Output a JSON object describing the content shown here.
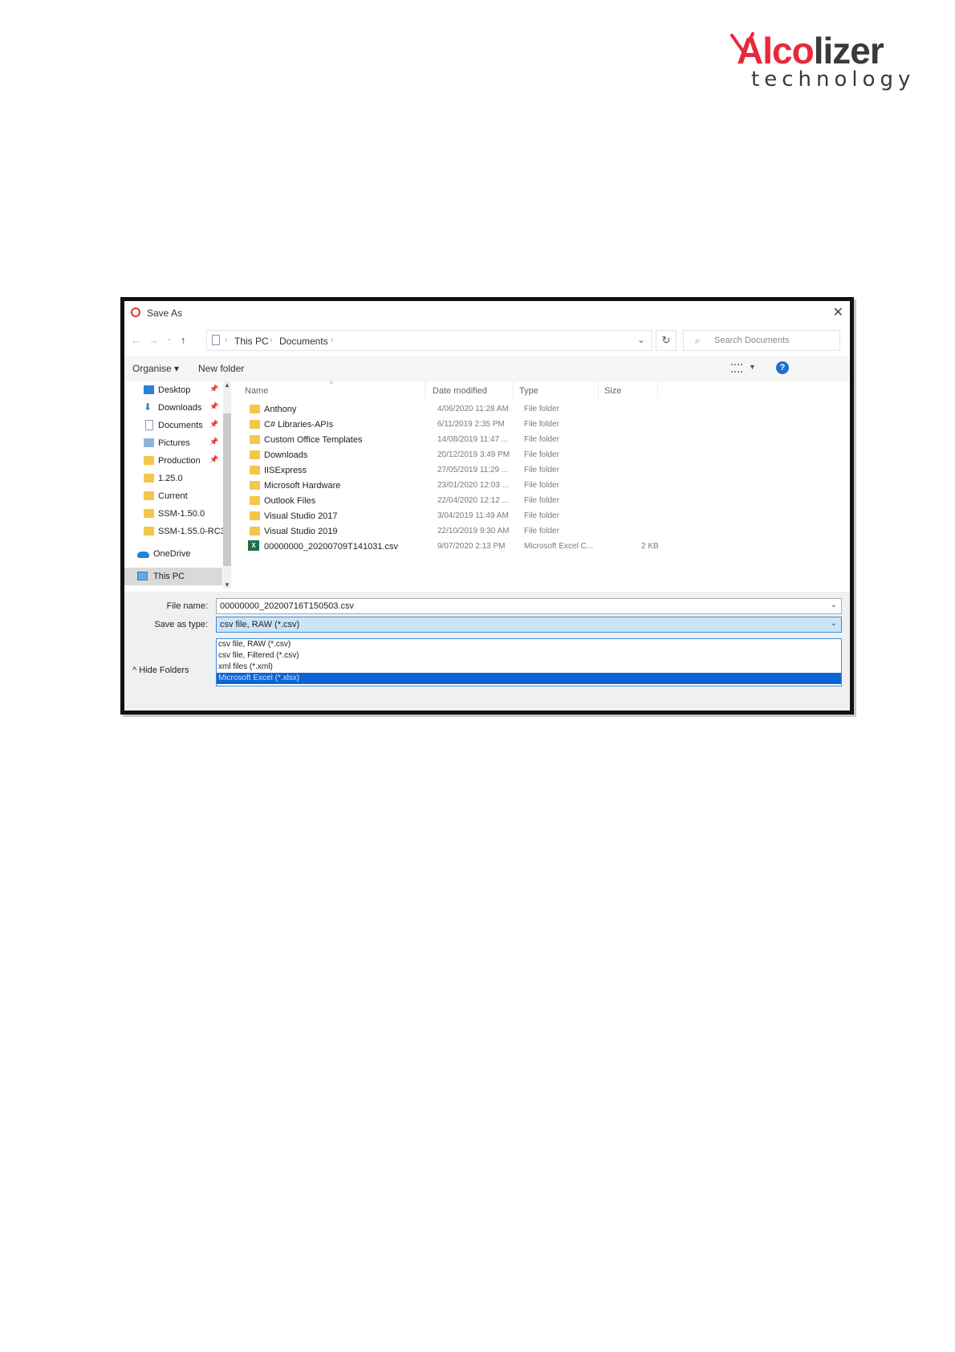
{
  "logo": {
    "brand_accent": "Alco",
    "brand_rest": "lizer",
    "tagline": "technology",
    "accent_color": "#e8293b"
  },
  "dialog": {
    "title": "Save As",
    "close_glyph": "✕",
    "nav": {
      "back": "←",
      "forward": "→",
      "recent": "⌄",
      "up": "↑"
    },
    "breadcrumb": [
      "This PC",
      "Documents"
    ],
    "breadcrumb_sep": "›",
    "refresh_glyph": "↻",
    "search_placeholder": "Search Documents",
    "toolbar": {
      "organise": "Organise ▾",
      "new_folder": "New folder"
    },
    "help_glyph": "?",
    "nav_pane": [
      {
        "label": "Desktop",
        "icon": "desktop-icon",
        "pinned": true
      },
      {
        "label": "Downloads",
        "icon": "download-icon",
        "pinned": true
      },
      {
        "label": "Documents",
        "icon": "document-icon",
        "pinned": true
      },
      {
        "label": "Pictures",
        "icon": "pictures-icon",
        "pinned": true
      },
      {
        "label": "Production",
        "icon": "folder-icon",
        "pinned": true
      },
      {
        "label": "1.25.0",
        "icon": "folder-icon",
        "pinned": false
      },
      {
        "label": "Current",
        "icon": "folder-icon",
        "pinned": false
      },
      {
        "label": "SSM-1.50.0",
        "icon": "folder-icon",
        "pinned": false
      },
      {
        "label": "SSM-1.55.0-RC3",
        "icon": "folder-icon",
        "pinned": false
      },
      {
        "label": "OneDrive",
        "icon": "cloud-icon",
        "pinned": false
      },
      {
        "label": "This PC",
        "icon": "computer-icon",
        "pinned": false
      }
    ],
    "columns": {
      "name": "Name",
      "date": "Date modified",
      "type": "Type",
      "size": "Size"
    },
    "files": [
      {
        "name": "Anthony",
        "date": "4/06/2020 11:28 AM",
        "type": "File folder",
        "size": "",
        "kind": "folder"
      },
      {
        "name": "C# Libraries-APIs",
        "date": "6/11/2019 2:35 PM",
        "type": "File folder",
        "size": "",
        "kind": "folder"
      },
      {
        "name": "Custom Office Templates",
        "date": "14/08/2019 11:47 ...",
        "type": "File folder",
        "size": "",
        "kind": "folder"
      },
      {
        "name": "Downloads",
        "date": "20/12/2019 3:49 PM",
        "type": "File folder",
        "size": "",
        "kind": "folder"
      },
      {
        "name": "IISExpress",
        "date": "27/05/2019 11:29 ...",
        "type": "File folder",
        "size": "",
        "kind": "folder"
      },
      {
        "name": "Microsoft Hardware",
        "date": "23/01/2020 12:03 ...",
        "type": "File folder",
        "size": "",
        "kind": "folder"
      },
      {
        "name": "Outlook Files",
        "date": "22/04/2020 12:12 ...",
        "type": "File folder",
        "size": "",
        "kind": "folder"
      },
      {
        "name": "Visual Studio 2017",
        "date": "3/04/2019 11:49 AM",
        "type": "File folder",
        "size": "",
        "kind": "folder"
      },
      {
        "name": "Visual Studio 2019",
        "date": "22/10/2019 9:30 AM",
        "type": "File folder",
        "size": "",
        "kind": "folder"
      },
      {
        "name": "00000000_20200709T141031.csv",
        "date": "9/07/2020 2:13 PM",
        "type": "Microsoft Excel C...",
        "size": "2 KB",
        "kind": "excel"
      }
    ],
    "file_name_label": "File name:",
    "file_name_value": "00000000_20200716T150503.csv",
    "save_type_label": "Save as type:",
    "save_type_value": "csv file, RAW (*.csv)",
    "save_type_options": [
      {
        "label": "csv file, RAW (*.csv)",
        "selected": false
      },
      {
        "label": "csv file, Filtered (*.csv)",
        "selected": false
      },
      {
        "label": "xml files (*.xml)",
        "selected": false
      },
      {
        "label": "Microsoft Excel (*.xlsx)",
        "selected": true
      }
    ],
    "hide_folders": "^  Hide Folders"
  }
}
